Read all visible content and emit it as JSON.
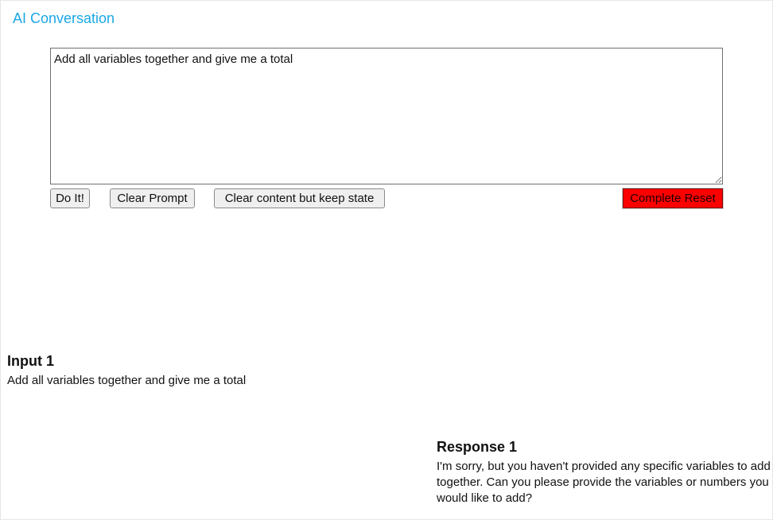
{
  "header": {
    "title": "AI Conversation"
  },
  "prompt": {
    "value": "Add all variables together and give me a total",
    "placeholder": ""
  },
  "toolbar": {
    "do_it_label": "Do It!",
    "clear_prompt_label": "Clear Prompt",
    "clear_content_label": "Clear content but keep state",
    "complete_reset_label": "Complete Reset"
  },
  "conversation": {
    "input": {
      "heading": "Input 1",
      "text": "Add all variables together and give me a total"
    },
    "response": {
      "heading": "Response 1",
      "text": "I'm sorry, but you haven't provided any specific variables to add together. Can you please provide the variables or numbers you would like to add?"
    }
  },
  "colors": {
    "title": "#1aa8e6",
    "reset_button": "#ff0000"
  }
}
